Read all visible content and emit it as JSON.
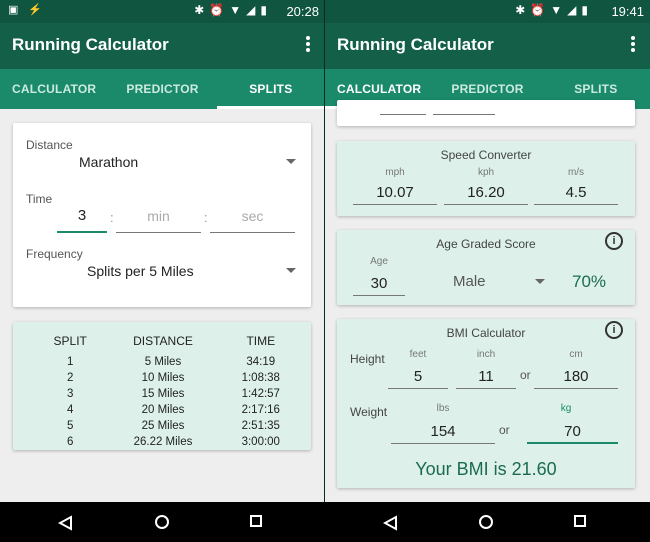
{
  "left": {
    "status": {
      "time": "20:28"
    },
    "app_title": "Running Calculator",
    "tabs": [
      "CALCULATOR",
      "PREDICTOR",
      "SPLITS"
    ],
    "active_tab": "SPLITS",
    "distance": {
      "label": "Distance",
      "value": "Marathon"
    },
    "time": {
      "label": "Time",
      "hours": "3",
      "sep1": ":",
      "minutes_placeholder": "min",
      "sep2": ":",
      "seconds_placeholder": "sec"
    },
    "frequency": {
      "label": "Frequency",
      "value": "Splits per 5 Miles"
    },
    "splits_table": {
      "headers": [
        "SPLIT",
        "DISTANCE",
        "TIME"
      ],
      "rows": [
        [
          "1",
          "5 Miles",
          "34:19"
        ],
        [
          "2",
          "10 Miles",
          "1:08:38"
        ],
        [
          "3",
          "15 Miles",
          "1:42:57"
        ],
        [
          "4",
          "20 Miles",
          "2:17:16"
        ],
        [
          "5",
          "25 Miles",
          "2:51:35"
        ],
        [
          "6",
          "26.22 Miles",
          "3:00:00"
        ]
      ]
    }
  },
  "right": {
    "status": {
      "time": "19:41"
    },
    "app_title": "Running Calculator",
    "tabs": [
      "CALCULATOR",
      "PREDICTOR",
      "SPLITS"
    ],
    "active_tab": "CALCULATOR",
    "speed_converter": {
      "title": "Speed Converter",
      "units": [
        "mph",
        "kph",
        "m/s"
      ],
      "values": [
        "10.07",
        "16.20",
        "4.5"
      ]
    },
    "age_graded": {
      "title": "Age Graded Score",
      "age_label": "Age",
      "age_value": "30",
      "gender": "Male",
      "score": "70%"
    },
    "bmi": {
      "title": "BMI Calculator",
      "height_label": "Height",
      "feet_label": "feet",
      "inch_label": "inch",
      "cm_label": "cm",
      "feet": "5",
      "inch": "11",
      "or1": "or",
      "cm": "180",
      "weight_label": "Weight",
      "lbs_label": "lbs",
      "kg_label": "kg",
      "lbs": "154",
      "or2": "or",
      "kg": "70",
      "result": "Your BMI is 21.60"
    }
  },
  "colors": {
    "primary_dark": "#0f5540",
    "primary": "#135f48",
    "accent": "#1a8a6b",
    "card_tint": "#ddf1ea"
  }
}
